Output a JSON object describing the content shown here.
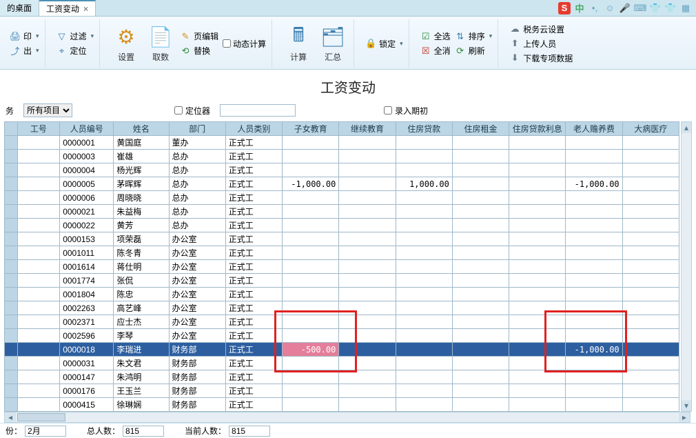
{
  "tabs": {
    "t0": "的桌面",
    "t1": "工资变动",
    "close": "×"
  },
  "tray": {
    "sogou": "S",
    "cn": "中"
  },
  "ribbon": {
    "print": "印",
    "export": "出",
    "filter": "过滤",
    "locate": "定位",
    "settings": "设置",
    "getdata": "取数",
    "pageedit": "页编辑",
    "replace": "替换",
    "dyncalc": "动态计算",
    "calc": "计算",
    "summary": "汇总",
    "lock": "锁定",
    "selall": "全选",
    "selnone": "全消",
    "sort": "排序",
    "refresh": "刷新",
    "taxcloud": "税务云设置",
    "upload": "上传人员",
    "download": "下载专项数据"
  },
  "title": "工资变动",
  "filters": {
    "dropdown_cut": "务",
    "project": "所有项目",
    "locator_label": "定位器",
    "period_label": "录入期初"
  },
  "columns": [
    "",
    "工号",
    "人员编号",
    "姓名",
    "部门",
    "人员类别",
    "子女教育",
    "继续教育",
    "住房贷款",
    "住房租金",
    "住房贷款利息",
    "老人赡养费",
    "大病医疗"
  ],
  "rows": [
    {
      "id": "0000001",
      "name": "黄国庭",
      "dept": "董办",
      "type": "正式工"
    },
    {
      "id": "0000003",
      "name": "崔雄",
      "dept": "总办",
      "type": "正式工"
    },
    {
      "id": "0000004",
      "name": "杨光辉",
      "dept": "总办",
      "type": "正式工"
    },
    {
      "id": "0000005",
      "name": "茅晖辉",
      "dept": "总办",
      "type": "正式工",
      "c6": "-1,000.00",
      "c8": "1,000.00",
      "c11": "-1,000.00"
    },
    {
      "id": "0000006",
      "name": "周晓晓",
      "dept": "总办",
      "type": "正式工"
    },
    {
      "id": "0000021",
      "name": "朱益梅",
      "dept": "总办",
      "type": "正式工"
    },
    {
      "id": "0000022",
      "name": "黄芳",
      "dept": "总办",
      "type": "正式工"
    },
    {
      "id": "0000153",
      "name": "项荣磊",
      "dept": "办公室",
      "type": "正式工"
    },
    {
      "id": "0001011",
      "name": "陈冬青",
      "dept": "办公室",
      "type": "正式工"
    },
    {
      "id": "0001614",
      "name": "蒋仕明",
      "dept": "办公室",
      "type": "正式工"
    },
    {
      "id": "0001774",
      "name": "张侃",
      "dept": "办公室",
      "type": "正式工"
    },
    {
      "id": "0001804",
      "name": "陈忠",
      "dept": "办公室",
      "type": "正式工"
    },
    {
      "id": "0002263",
      "name": "高艺峰",
      "dept": "办公室",
      "type": "正式工"
    },
    {
      "id": "0002371",
      "name": "应士杰",
      "dept": "办公室",
      "type": "正式工"
    },
    {
      "id": "0002596",
      "name": "李琴",
      "dept": "办公室",
      "type": "正式工"
    },
    {
      "id": "0000018",
      "name": "李瑞进",
      "dept": "财务部",
      "type": "正式工",
      "c6": "-500.00",
      "c11": "-1,000.00",
      "selected": true
    },
    {
      "id": "0000031",
      "name": "朱文君",
      "dept": "财务部",
      "type": "正式工"
    },
    {
      "id": "0000147",
      "name": "朱鸿明",
      "dept": "财务部",
      "type": "正式工"
    },
    {
      "id": "0000176",
      "name": "王玉兰",
      "dept": "财务部",
      "type": "正式工"
    },
    {
      "id": "0000415",
      "name": "徐琳娴",
      "dept": "财务部",
      "type": "正式工"
    }
  ],
  "status": {
    "month_label": "份：",
    "month_value": "2月",
    "total_label": "总人数：",
    "total_value": "815",
    "cur_label": "当前人数：",
    "cur_value": "815"
  }
}
